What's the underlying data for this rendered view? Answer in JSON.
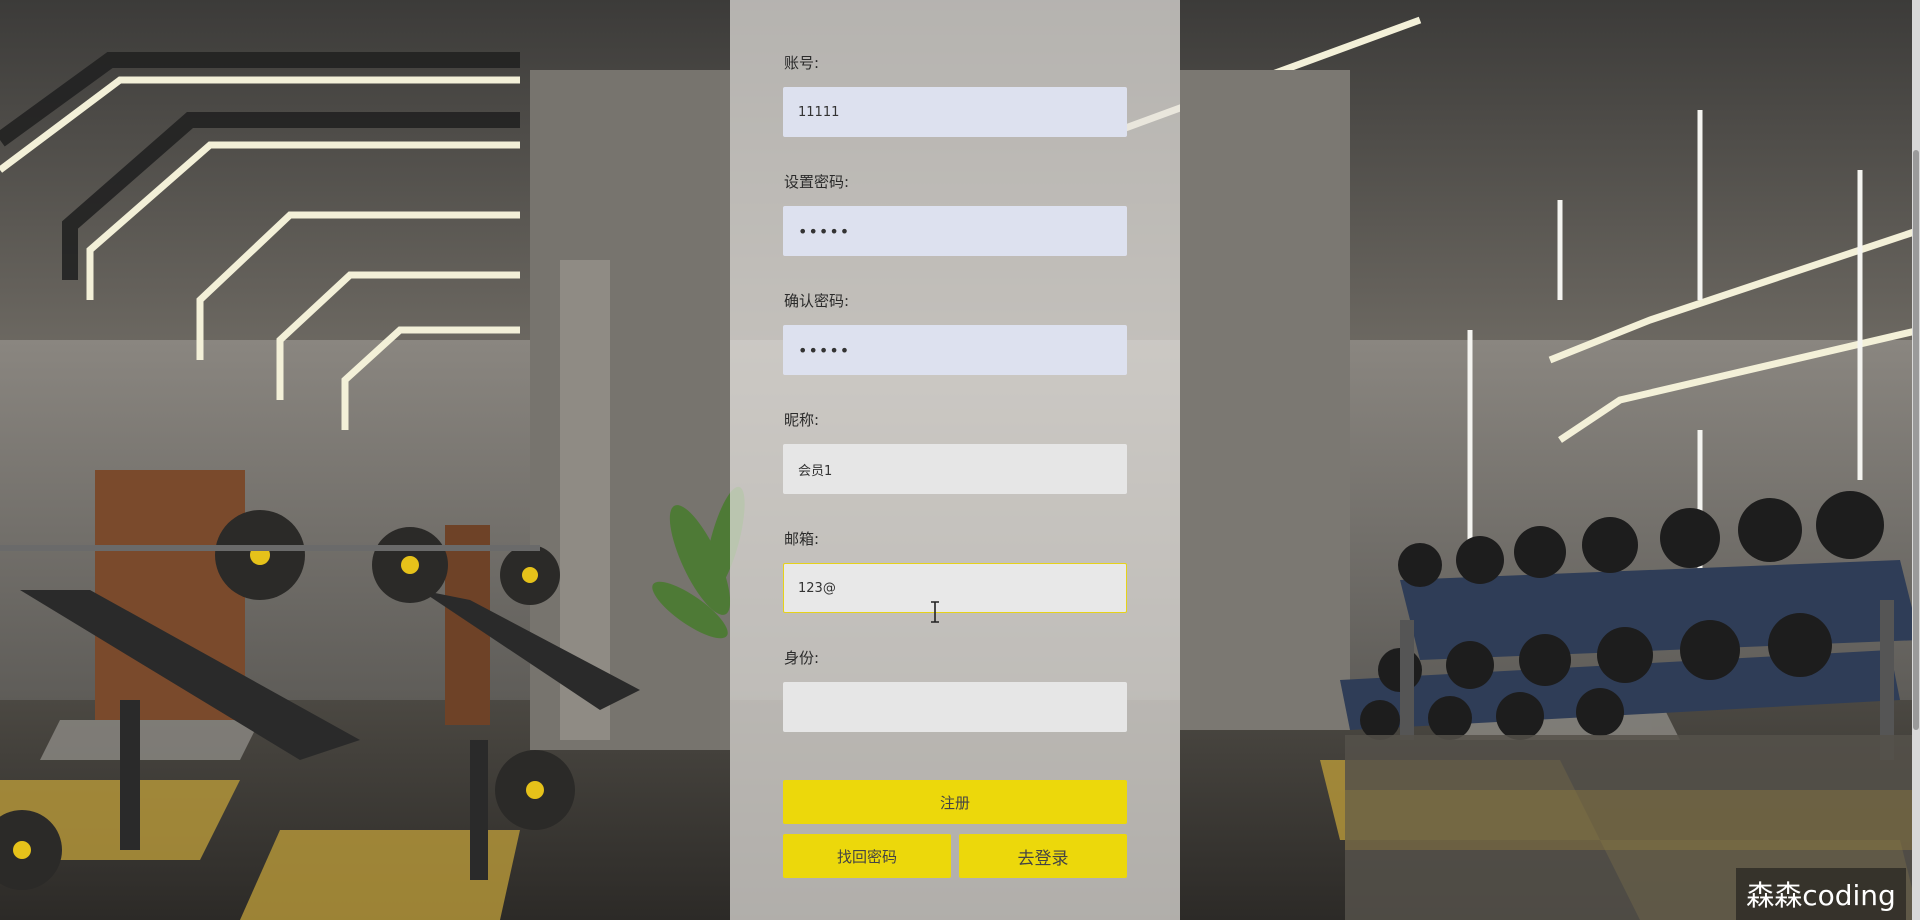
{
  "form": {
    "account": {
      "label": "账号:",
      "value": "11111"
    },
    "password": {
      "label": "设置密码:",
      "value": "•••••"
    },
    "confirm_password": {
      "label": "确认密码:",
      "value": "•••••"
    },
    "nickname": {
      "label": "昵称:",
      "value": "会员1"
    },
    "email": {
      "label": "邮箱:",
      "value": "123@"
    },
    "identity": {
      "label": "身份:",
      "value": ""
    }
  },
  "buttons": {
    "register": "注册",
    "find_password": "找回密码",
    "go_login": "去登录"
  },
  "watermark": "森森coding",
  "colors": {
    "accent": "#ecd80b",
    "panel": "#e4e2de",
    "filled_input": "#dde1ef"
  }
}
